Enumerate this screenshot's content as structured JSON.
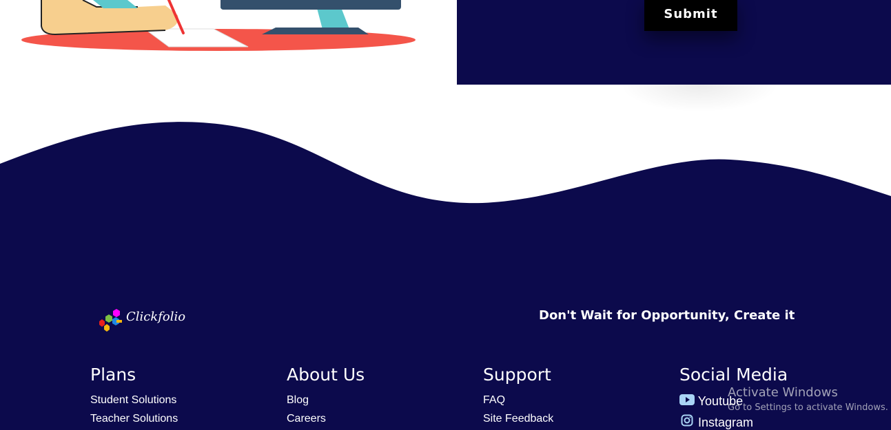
{
  "form": {
    "submit_label": "Submit"
  },
  "footer": {
    "brand": "Clickfolio",
    "tagline": "Don't Wait for Opportunity, Create it",
    "columns": [
      {
        "title": "Plans",
        "links": [
          "Student Solutions",
          "Teacher Solutions"
        ]
      },
      {
        "title": "About Us",
        "links": [
          "Blog",
          "Careers"
        ]
      },
      {
        "title": "Support",
        "links": [
          "FAQ",
          "Site Feedback"
        ]
      },
      {
        "title": "Social Media",
        "links": [
          "Youtube",
          "Instagram"
        ]
      }
    ],
    "social_icons": [
      "youtube-icon",
      "instagram-icon"
    ]
  },
  "os_overlay": {
    "line1": "Activate Windows",
    "line2": "Go to Settings to activate Windows."
  },
  "colors": {
    "navy": "#0c0a4c",
    "table_red": "#f4554a",
    "monitor_teal": "#5cc8cc",
    "monitor_dark": "#34506c",
    "skin": "#f7cf8e"
  }
}
